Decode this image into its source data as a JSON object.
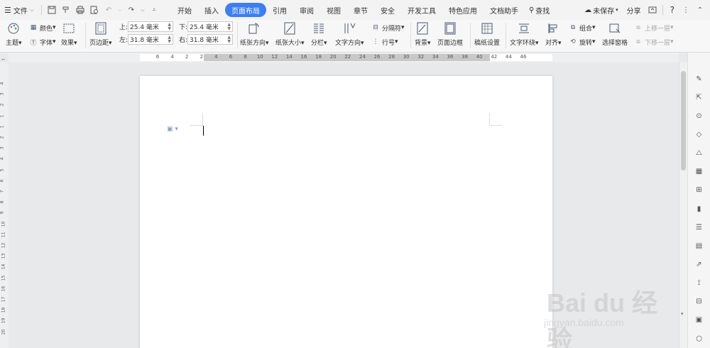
{
  "menubar": {
    "file_label": "文件",
    "tabs": [
      "开始",
      "插入",
      "页面布局",
      "引用",
      "审阅",
      "视图",
      "章节",
      "安全",
      "开发工具",
      "特色应用",
      "文档助手"
    ],
    "active_tab": "页面布局",
    "search_label": "查找",
    "unsaved_label": "未保存",
    "share_label": "分享",
    "help_label": "?"
  },
  "ribbon": {
    "theme_label": "主题",
    "color_label": "颜色",
    "font_label": "字体",
    "effect_label": "效果",
    "margin_label": "页边距",
    "top_label": "上:",
    "top_value": "25.4 毫米",
    "bottom_label": "下:",
    "bottom_value": "25.4 毫米",
    "left_label": "左:",
    "left_value": "31.8 毫米",
    "right_label": "右:",
    "right_value": "31.8 毫米",
    "orientation_label": "纸张方向",
    "size_label": "纸张大小",
    "columns_label": "分栏",
    "text_direction_label": "文字方向",
    "separator_label": "分隔符",
    "line_number_label": "行号",
    "background_label": "背景",
    "page_border_label": "页面边框",
    "manuscript_label": "稿纸设置",
    "wrap_label": "文字环绕",
    "align_label": "对齐",
    "group_label": "组合",
    "rotate_label": "旋转",
    "selection_pane_label": "选择窗格",
    "bring_forward_label": "上移一层",
    "send_backward_label": "下移一层"
  },
  "ruler": {
    "h_ticks": [
      "6",
      "4",
      "2",
      "2",
      "4",
      "6",
      "8",
      "10",
      "12",
      "14",
      "16",
      "18",
      "20",
      "22",
      "24",
      "26",
      "28",
      "30",
      "32",
      "34",
      "36",
      "38",
      "40",
      "42",
      "44",
      "46"
    ],
    "v_ticks": [
      "4",
      "3",
      "2",
      "1",
      "1",
      "2",
      "3",
      "4",
      "5",
      "6",
      "7",
      "8",
      "9",
      "10",
      "11",
      "12",
      "13",
      "14",
      "15",
      "16",
      "17",
      "18",
      "19",
      "20"
    ]
  },
  "watermark": {
    "main": "Bai du 经验",
    "sub": "jingyan.baidu.com"
  },
  "colors": {
    "accent": "#3d7ef0",
    "menubar_bg": "#f3f3f3",
    "ribbon_bg": "#f7f7f7",
    "canvas_bg": "#e8e9eb"
  }
}
